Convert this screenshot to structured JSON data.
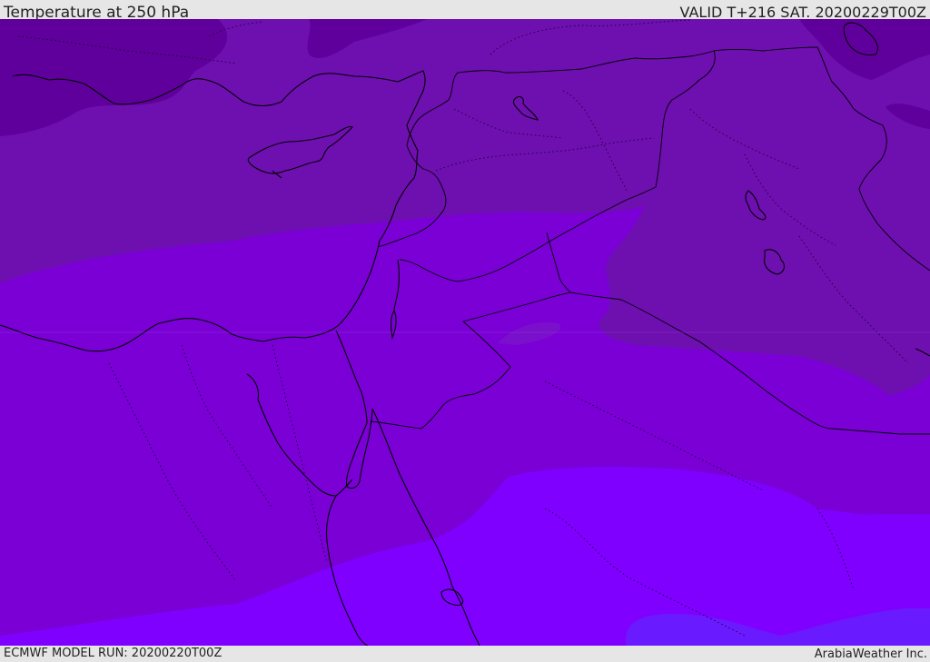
{
  "header": {
    "title": "Temperature at 250 hPa",
    "valid": "VALID T+216 SAT. 20200229T00Z"
  },
  "footer": {
    "model_run": "ECMWF MODEL RUN: 20200220T00Z",
    "credit": "ArabiaWeather Inc."
  },
  "colors": {
    "band_coldest": "#60009c",
    "band_cold": "#6e0fb0",
    "band_mid": "#7a00d6",
    "band_warm": "#7e00ee",
    "band_warmest": "#8000ff",
    "band_patch": "#6a1aff",
    "coastline": "#000000",
    "header_bg": "#e6e6e6"
  }
}
